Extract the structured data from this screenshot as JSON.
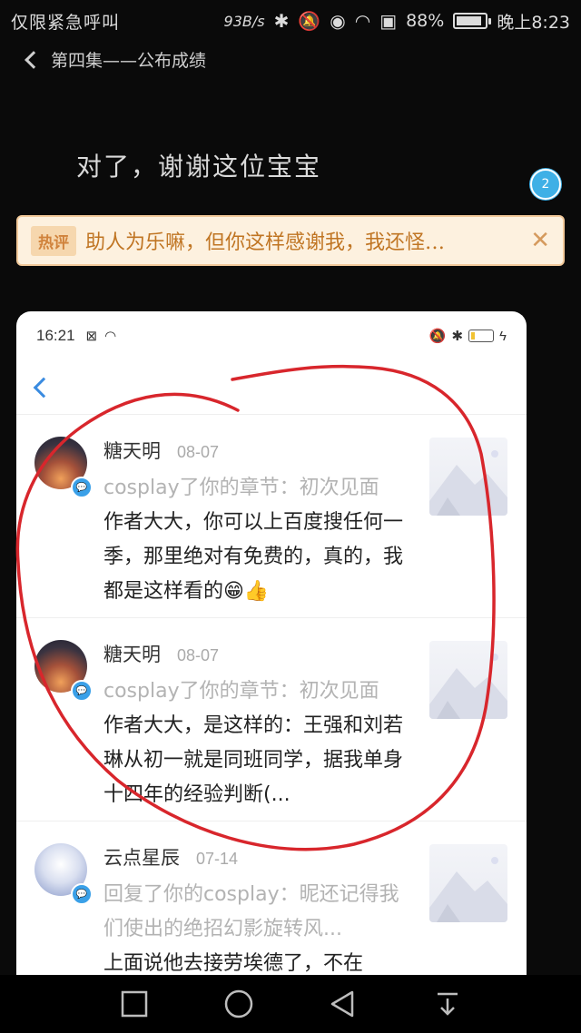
{
  "status_bar": {
    "carrier": "仅限紧急呼叫",
    "net_speed": "93B/s",
    "icons": [
      "bluetooth-icon",
      "mute-icon",
      "eye-icon",
      "wifi-icon",
      "sim-icon"
    ],
    "battery_percent": "88%",
    "battery_level": 0.88,
    "time": "晚上8:23"
  },
  "top_nav": {
    "title": "第四集——公布成绩"
  },
  "body": {
    "text": "对了，谢谢这位宝宝"
  },
  "hot_comment": {
    "tag": "热评",
    "text": "助人为乐嘛，但你这样感谢我，我还怪…",
    "badge_count": "2"
  },
  "inner_screen": {
    "status": {
      "time": "16:21",
      "battery_level": 0.2
    },
    "items": [
      {
        "name": "糖天明",
        "date": "08-07",
        "ref": "cosplay了你的章节：初次见面",
        "content": "作者大大，你可以上百度搜任何一季，那里绝对有免费的，真的，我都是这样看的😁👍",
        "avatar": "sunset"
      },
      {
        "name": "糖天明",
        "date": "08-07",
        "ref": "cosplay了你的章节：初次见面",
        "content": "作者大大，是这样的：王强和刘若琳从初一就是同班同学，据我单身十四年的经验判断(...",
        "avatar": "sunset"
      },
      {
        "name": "云点星辰",
        "date": "07-14",
        "ref": "回复了你的cosplay：昵还记得我们使出的绝招幻影旋转风...",
        "content": "上面说他去接劳埃德了，不在",
        "avatar": "anime"
      }
    ]
  },
  "colors": {
    "accent_blue": "#3aa0e8",
    "hot_orange": "#c07523",
    "annotation_red": "#d8262c"
  }
}
